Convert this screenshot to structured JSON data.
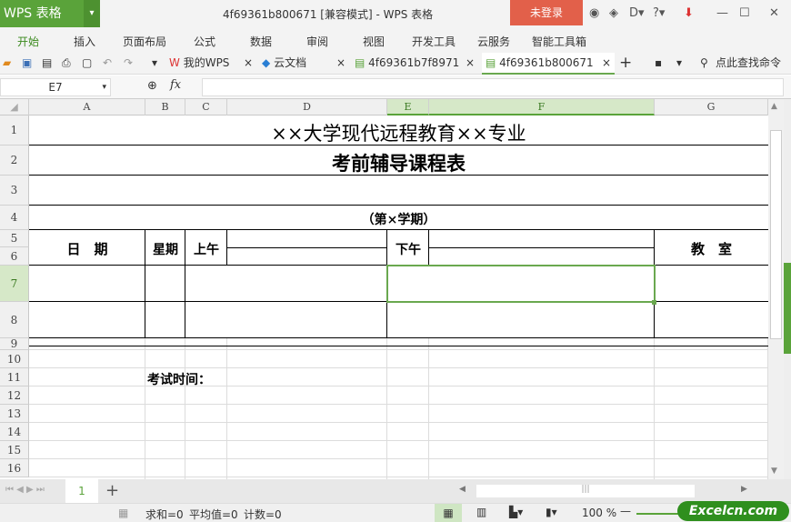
{
  "app": {
    "logo": "WPS 表格",
    "title": "4f69361b800671 [兼容模式] - WPS 表格",
    "login": "未登录"
  },
  "menu": [
    "开始",
    "插入",
    "页面布局",
    "公式",
    "数据",
    "审阅",
    "视图",
    "开发工具",
    "云服务",
    "智能工具箱"
  ],
  "tabs": [
    {
      "label": "我的WPS"
    },
    {
      "label": "云文档"
    },
    {
      "label": "4f69361b7f8971"
    },
    {
      "label": "4f69361b800671"
    }
  ],
  "search_cmd": "点此查找命令",
  "formula": {
    "cell_ref": "E7",
    "fx": "fx",
    "value": ""
  },
  "columns": [
    "A",
    "B",
    "C",
    "D",
    "E",
    "F",
    "G"
  ],
  "rows": [
    "1",
    "2",
    "3",
    "4",
    "5",
    "6",
    "7",
    "8",
    "9",
    "10",
    "11",
    "12",
    "13",
    "14",
    "15",
    "16"
  ],
  "sheet": {
    "title1": "××大学现代远程教育××专业",
    "title2": "考前辅导课程表",
    "semester": "（第×学期）",
    "h_date": "日　期",
    "h_weekday": "星期",
    "h_am": "上午",
    "h_pm": "下午",
    "h_room": "教　室",
    "exam_time": "考试时间："
  },
  "sheet_tabs": [
    "1"
  ],
  "status": {
    "sum": "求和=0",
    "avg": "平均值=0",
    "count": "计数=0",
    "zoom": "100 %"
  },
  "watermark": "Excelcn.com",
  "accent": "#5aa33a"
}
